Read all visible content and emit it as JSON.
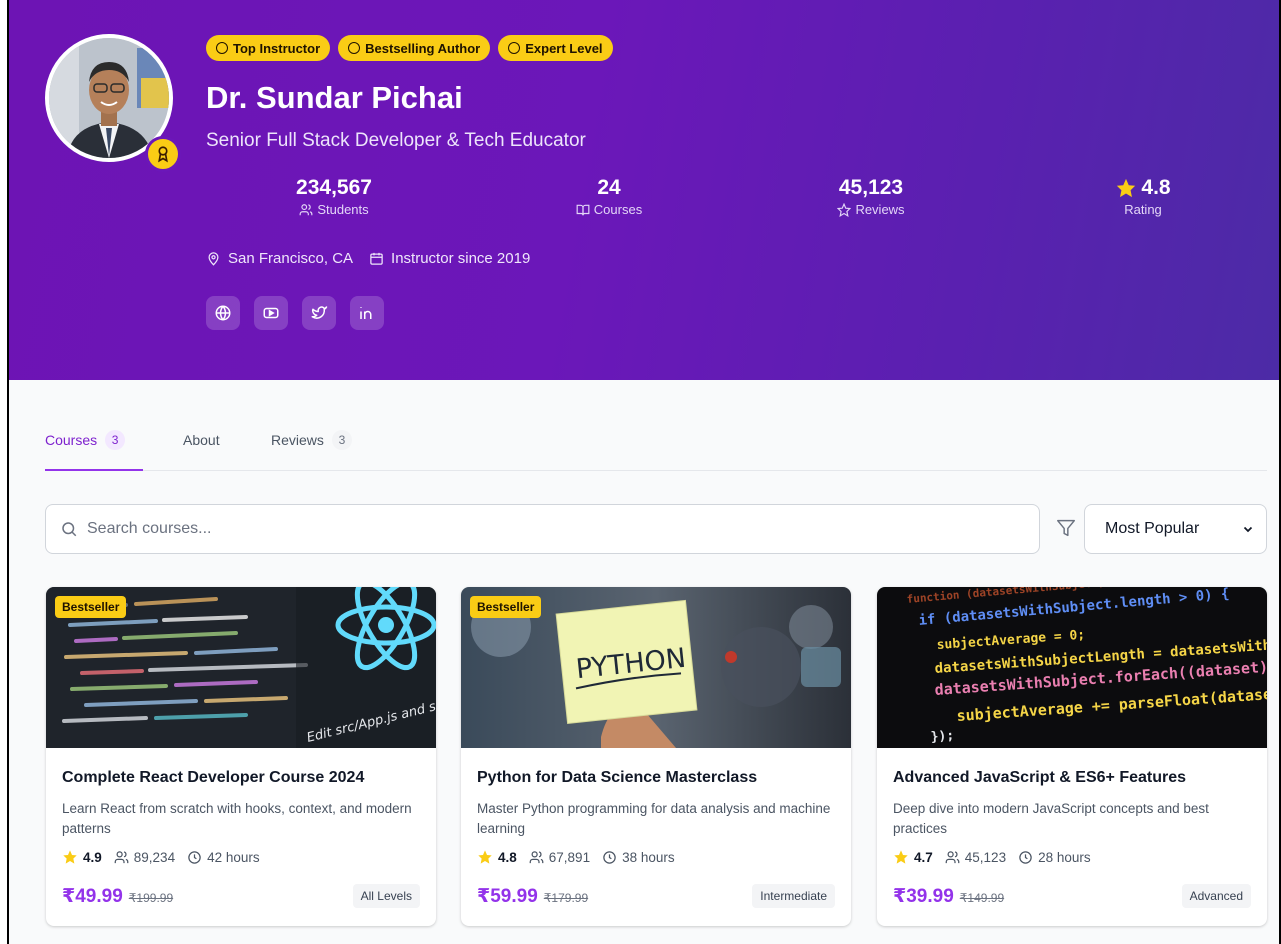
{
  "profile": {
    "badges": [
      "Top Instructor",
      "Bestselling Author",
      "Expert Level"
    ],
    "name": "Dr. Sundar Pichai",
    "title": "Senior Full Stack Developer & Tech Educator",
    "stats": [
      {
        "value": "234,567",
        "label": "Students",
        "icon": "users-icon"
      },
      {
        "value": "24",
        "label": "Courses",
        "icon": "book-open-icon"
      },
      {
        "value": "45,123",
        "label": "Reviews",
        "icon": "star-outline-icon"
      },
      {
        "value": "4.8",
        "label": "Rating",
        "icon": "star-filled-icon"
      }
    ],
    "location": "San Francisco, CA",
    "since": "Instructor since 2019",
    "socials": [
      "globe-icon",
      "youtube-icon",
      "twitter-icon",
      "linkedin-icon"
    ]
  },
  "colors": {
    "accent": "#9333ea",
    "badge": "#facc15",
    "hero_start": "#6d14b4",
    "hero_end": "#4c2ba6"
  },
  "tabs": [
    {
      "label": "Courses",
      "count": "3",
      "active": true
    },
    {
      "label": "About",
      "count": null,
      "active": false
    },
    {
      "label": "Reviews",
      "count": "3",
      "active": false
    }
  ],
  "search": {
    "placeholder": "Search courses..."
  },
  "sort": {
    "selected": "Most Popular"
  },
  "courses": [
    {
      "badge": "Bestseller",
      "title": "Complete React Developer Course 2024",
      "description": "Learn React from scratch with hooks, context, and modern patterns",
      "rating": "4.9",
      "students": "89,234",
      "duration": "42 hours",
      "price": "₹49.99",
      "original_price": "₹199.99",
      "level": "All Levels"
    },
    {
      "badge": "Bestseller",
      "title": "Python for Data Science Masterclass",
      "description": "Master Python programming for data analysis and machine learning",
      "rating": "4.8",
      "students": "67,891",
      "duration": "38 hours",
      "price": "₹59.99",
      "original_price": "₹179.99",
      "level": "Intermediate"
    },
    {
      "badge": null,
      "title": "Advanced JavaScript & ES6+ Features",
      "description": "Deep dive into modern JavaScript concepts and best practices",
      "rating": "4.7",
      "students": "45,123",
      "duration": "28 hours",
      "price": "₹39.99",
      "original_price": "₹149.99",
      "level": "Advanced"
    }
  ],
  "thumbnails": {
    "react": {
      "code_text": "Edit src/App.js and save to reload"
    },
    "python": {
      "sticky_note": "PYTHON"
    },
    "javascript": {
      "code_lines": [
        "function (datasetsWithSubject) {",
        "if (datasetsWithSubject.length > 0) {",
        "subjectAverage = 0;",
        "datasetsWithSubjectLength = datasetsWithSu",
        "datasetsWithSubject.forEach((dataset) => {",
        "subjectAverage += parseFloat(dataset[",
        "});"
      ]
    }
  }
}
